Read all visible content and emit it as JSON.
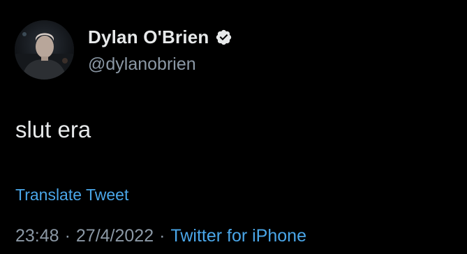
{
  "author": {
    "display_name": "Dylan O'Brien",
    "handle": "@dylanobrien",
    "verified_icon": "verified-badge-icon",
    "avatar_icon": "profile-photo"
  },
  "tweet": {
    "text": "slut era",
    "translate_label": "Translate Tweet"
  },
  "meta": {
    "time": "23:48",
    "separator": "·",
    "date": "27/4/2022",
    "source": "Twitter for iPhone"
  },
  "colors": {
    "background": "#000000",
    "primary_text": "#e7e9ea",
    "secondary_text": "#8b98a5",
    "link": "#4aa6e8"
  }
}
